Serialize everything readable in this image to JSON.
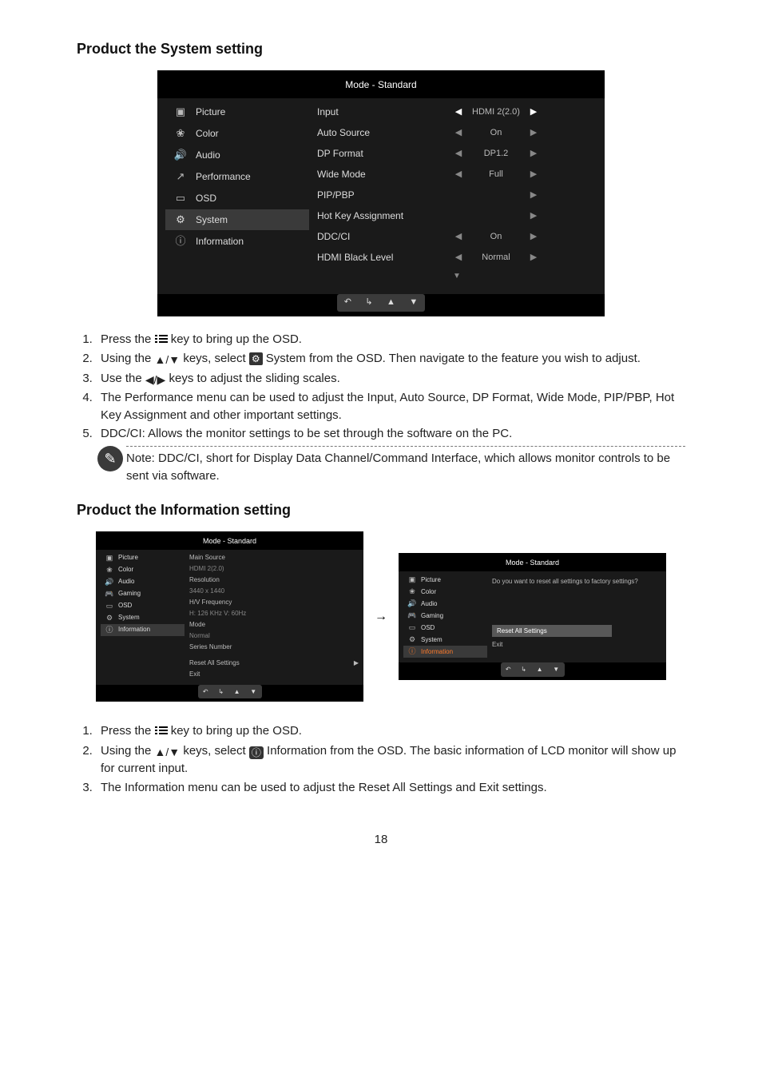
{
  "sections": {
    "system_heading": "Product the System setting",
    "info_heading": "Product the Information setting"
  },
  "osd_main": {
    "title": "Mode - Standard",
    "menu": [
      "Picture",
      "Color",
      "Audio",
      "Performance",
      "OSD",
      "System",
      "Information"
    ],
    "rows": [
      {
        "label": "Input",
        "left": "◀",
        "val": "HDMI 2(2.0)",
        "right": "▶",
        "lit": true
      },
      {
        "label": "Auto Source",
        "left": "◀",
        "val": "On",
        "right": "▶"
      },
      {
        "label": "DP Format",
        "left": "◀",
        "val": "DP1.2",
        "right": "▶"
      },
      {
        "label": "Wide Mode",
        "left": "◀",
        "val": "Full",
        "right": "▶"
      },
      {
        "label": "PIP/PBP",
        "left": "",
        "val": "",
        "right": "▶"
      },
      {
        "label": "Hot Key Assignment",
        "left": "",
        "val": "",
        "right": "▶"
      },
      {
        "label": "DDC/CI",
        "left": "◀",
        "val": "On",
        "right": "▶"
      },
      {
        "label": "HDMI Black Level",
        "left": "◀",
        "val": "Normal",
        "right": "▶"
      }
    ]
  },
  "instr_system": {
    "i1a": "Press the ",
    "i1b": " key to bring up the OSD.",
    "i2a": "Using the ",
    "i2b": " keys, select ",
    "i2c": " System from the OSD. Then navigate to the feature you wish to adjust.",
    "i3a": "Use the ",
    "i3b": " keys to adjust the sliding scales.",
    "i4": "The Performance menu can be used to adjust the Input, Auto Source, DP Format, Wide Mode, PIP/PBP, Hot Key Assignment and other important settings.",
    "i5": "DDC/CI: Allows the monitor settings to be set through the software on the PC."
  },
  "note": "Note: DDC/CI, short for Display Data Channel/Command Interface, which allows monitor controls to be sent via software.",
  "osd_info_left": {
    "title": "Mode - Standard",
    "menu": [
      "Picture",
      "Color",
      "Audio",
      "Gaming",
      "OSD",
      "System",
      "Information"
    ],
    "lines": {
      "main_source_label": "Main Source",
      "main_source_value": "HDMI 2(2.0)",
      "resolution_label": "Resolution",
      "resolution_value": "3440 x 1440",
      "hv_label": "H/V Frequency",
      "hv_value": "H: 126 KHz   V: 60Hz",
      "mode_label": "Mode",
      "mode_value": "Normal",
      "serial_label": "Series Number"
    },
    "reset": "Reset All Settings",
    "exit": "Exit"
  },
  "osd_info_right": {
    "title": "Mode - Standard",
    "menu": [
      "Picture",
      "Color",
      "Audio",
      "Gaming",
      "OSD",
      "System",
      "Information"
    ],
    "prompt": "Do you want to reset all settings to factory settings?",
    "reset": "Reset All Settings",
    "exit": "Exit"
  },
  "instr_info": {
    "i1a": "Press the ",
    "i1b": " key to bring up the OSD.",
    "i2a": "Using the ",
    "i2b": " keys, select ",
    "i2c": " Information from the OSD. The basic information of LCD monitor will show up for current input.",
    "i3": "The Information menu can be used to adjust the Reset All Settings and Exit settings."
  },
  "pagenum": "18",
  "icons": {
    "updown": "▲/▼",
    "leftright": "◀/▶"
  }
}
